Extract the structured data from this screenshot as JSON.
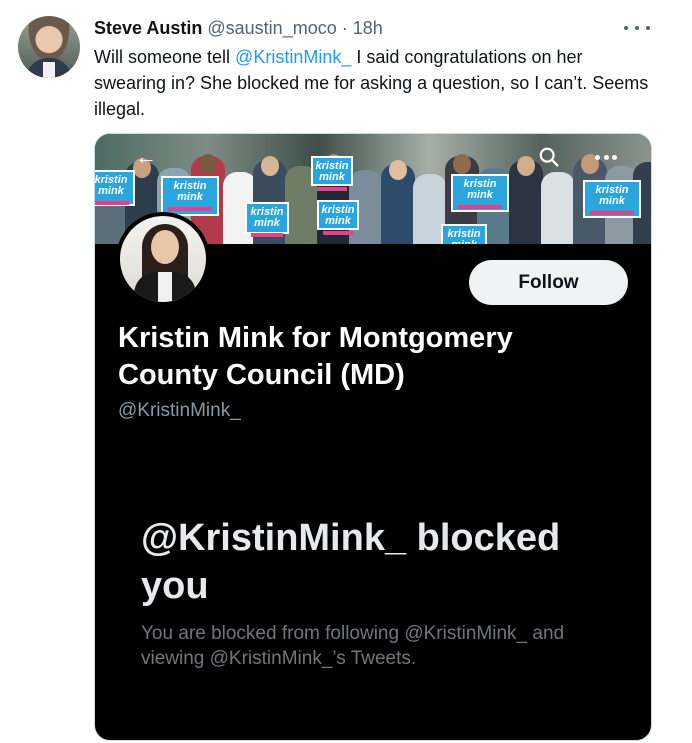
{
  "tweet": {
    "author_name": "Steve Austin",
    "author_handle": "@saustin_moco",
    "separator": "·",
    "time": "18h",
    "text_before": "Will someone tell ",
    "mention": "@KristinMink_",
    "text_after": " I said congratulations on her swearing in? She blocked me for asking a question, so I can’t. Seems illegal."
  },
  "icons": {
    "more": "more-horizontal-icon",
    "back": "back-arrow-icon",
    "search": "search-icon"
  },
  "screenshot": {
    "banner_signs": [
      "kristin mink",
      "kristin mink",
      "kristin mink",
      "kristin mink",
      "kristin mink",
      "kristin mink",
      "kristin mink",
      "kristin mink"
    ],
    "follow_label": "Follow",
    "display_name": "Kristin Mink for Montgomery County Council (MD)",
    "handle": "@KristinMink_",
    "blocked_title": "@KristinMink_ blocked you",
    "blocked_desc": "You are blocked from following @KristinMink_ and viewing @KristinMink_’s Tweets."
  },
  "colors": {
    "accent": "#1d9bf0",
    "text": "#0f1419",
    "muted": "#536471",
    "sign_blue": "#29a6de",
    "sign_pink": "#e83e8c"
  }
}
